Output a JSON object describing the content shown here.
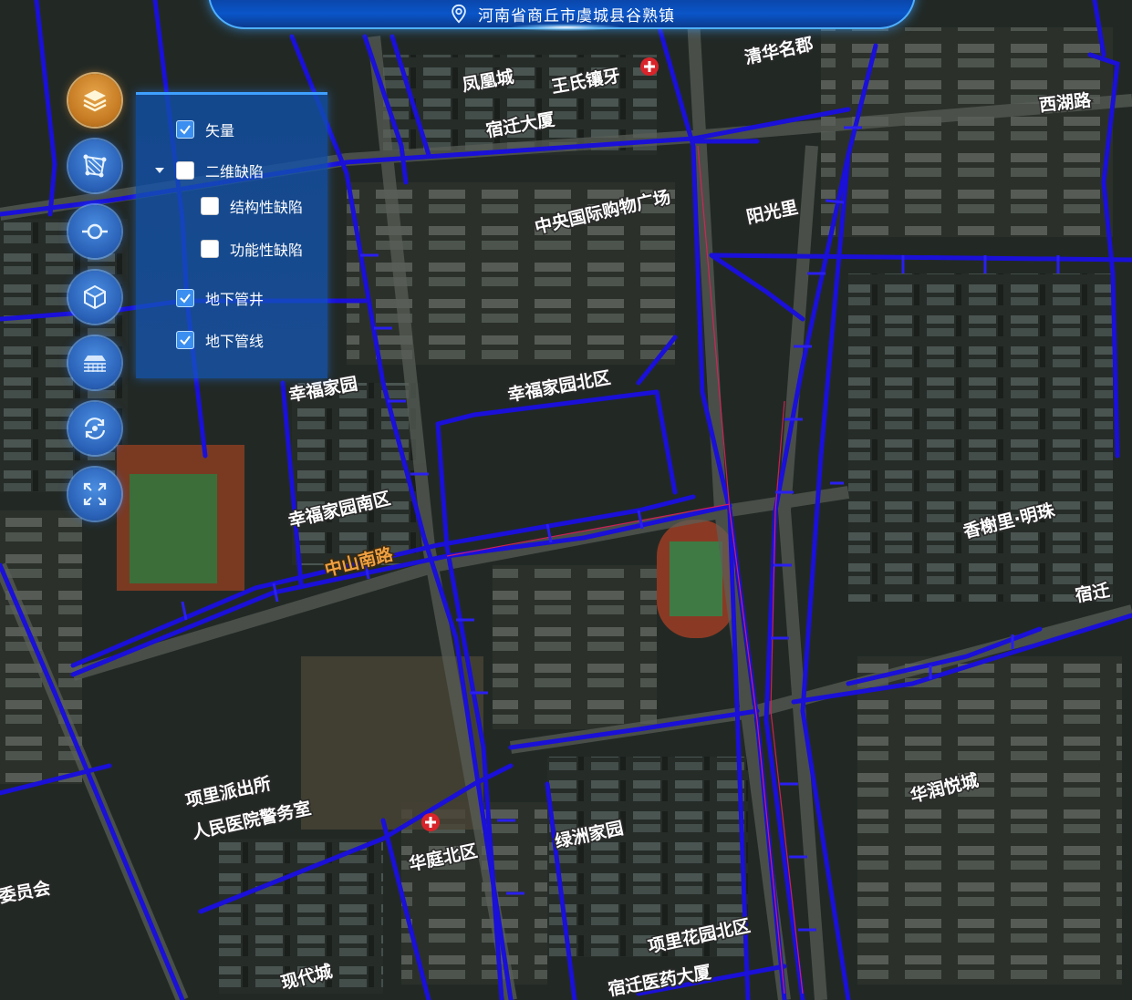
{
  "header": {
    "location": "河南省商丘市虞城县谷熟镇",
    "location_icon": "location-pin-icon"
  },
  "toolbar": {
    "buttons": [
      {
        "name": "layers",
        "icon": "layers-icon",
        "active": true
      },
      {
        "name": "area-measure",
        "icon": "polygon-measure-icon",
        "active": false
      },
      {
        "name": "pipe-node",
        "icon": "pipe-node-icon",
        "active": false
      },
      {
        "name": "3d-model",
        "icon": "cube-icon",
        "active": false
      },
      {
        "name": "underground",
        "icon": "underground-view-icon",
        "active": false
      },
      {
        "name": "rotate",
        "icon": "rotate-view-icon",
        "active": false
      },
      {
        "name": "fullscreen",
        "icon": "fullscreen-icon",
        "active": false
      }
    ]
  },
  "layer_panel": {
    "items": [
      {
        "label": "矢量",
        "checked": true,
        "indent": 0
      },
      {
        "label": "二维缺陷",
        "checked": false,
        "indent": 0,
        "expandable": true
      },
      {
        "label": "结构性缺陷",
        "checked": false,
        "indent": 1
      },
      {
        "label": "功能性缺陷",
        "checked": false,
        "indent": 1
      },
      {
        "label": "地下管井",
        "checked": true,
        "indent": 0
      },
      {
        "label": "地下管线",
        "checked": true,
        "indent": 0
      }
    ]
  },
  "map": {
    "pipe_color": "#1a10d8",
    "defect_line_color": "#e0205a",
    "place_labels": [
      "凤凰城",
      "王氏镶牙",
      "清华名郡",
      "西湖路",
      "宿迁大厦",
      "中央国际购物广场",
      "阳光里",
      "幸福家园",
      "幸福家园北区",
      "幸福家园南区",
      "中山南路",
      "香榭里·明珠",
      "项里派出所",
      "人民医院警务室",
      "华润悦城",
      "绿洲家园",
      "项里花园北区",
      "宿迁医药大厦",
      "现代城",
      "委员会",
      "宿迁",
      "华庭北区"
    ]
  }
}
